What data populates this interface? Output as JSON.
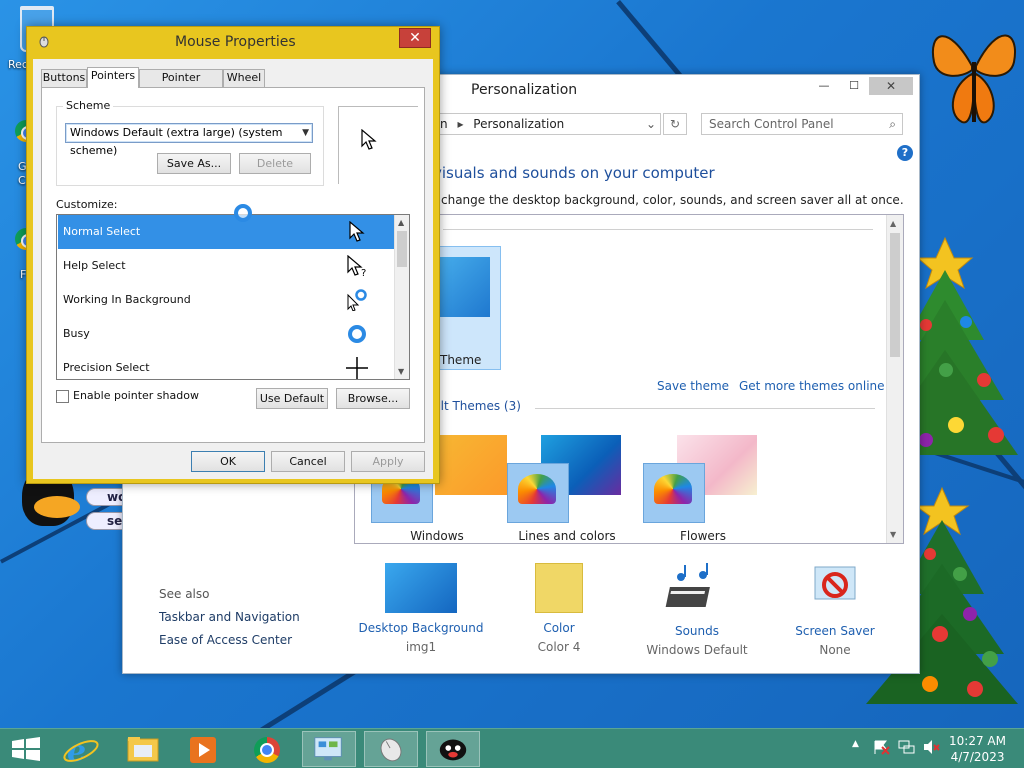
{
  "desktop": {
    "recycle_label": "Rec",
    "icon2_label": "G\nC",
    "icon3_label": "F",
    "bubble1": "wo",
    "bubble2": "se"
  },
  "mouse_dialog": {
    "title": "Mouse Properties",
    "close": "✕",
    "tabs": [
      "Buttons",
      "Pointers",
      "Pointer Options",
      "Wheel"
    ],
    "active_tab": "Pointers",
    "scheme_label": "Scheme",
    "scheme_value": "Windows Default (extra large) (system scheme)",
    "save_as": "Save As...",
    "delete": "Delete",
    "customize_label": "Customize:",
    "cursors": [
      {
        "label": "Normal Select",
        "icon": "arrow-cursor-icon"
      },
      {
        "label": "Help Select",
        "icon": "help-cursor-icon"
      },
      {
        "label": "Working In Background",
        "icon": "working-cursor-icon"
      },
      {
        "label": "Busy",
        "icon": "busy-cursor-icon"
      },
      {
        "label": "Precision Select",
        "icon": "crosshair-cursor-icon"
      }
    ],
    "enable_shadow": "Enable pointer shadow",
    "use_default": "Use Default",
    "browse": "Browse...",
    "ok": "OK",
    "cancel": "Cancel",
    "apply": "Apply"
  },
  "personalization": {
    "title": "Personalization",
    "minimize": "—",
    "maximize": "☐",
    "close": "✕",
    "address_fragment": "n",
    "address_current": "Personalization",
    "search_placeholder": "Search Control Panel",
    "heading": "visuals and sounds on your computer",
    "subtext": "change the desktop background, color, sounds, and screen saver all at once.",
    "selected_theme_label": "Theme",
    "selected_theme_count_fragment": ")",
    "save_theme": "Save theme",
    "get_more_themes": "Get more themes online",
    "default_themes_heading": "ult Themes (3)",
    "themes": [
      {
        "label": "Windows"
      },
      {
        "label": "Lines and colors"
      },
      {
        "label": "Flowers"
      }
    ],
    "see_also": "See also",
    "side_links": [
      "Taskbar and Navigation",
      "Ease of Access Center"
    ],
    "bottom_items": [
      {
        "title": "Desktop Background",
        "sub": "img1"
      },
      {
        "title": "Color",
        "sub": "Color 4"
      },
      {
        "title": "Sounds",
        "sub": "Windows Default"
      },
      {
        "title": "Screen Saver",
        "sub": "None"
      }
    ]
  },
  "taskbar": {
    "time": "10:27 AM",
    "date": "4/7/2023",
    "tray_up": "▲"
  },
  "colors": {
    "selection_blue": "#3390e6",
    "dialog_frame": "#e8c61f",
    "taskbar": "#3a8a79",
    "link_blue": "#1e5fb0"
  }
}
